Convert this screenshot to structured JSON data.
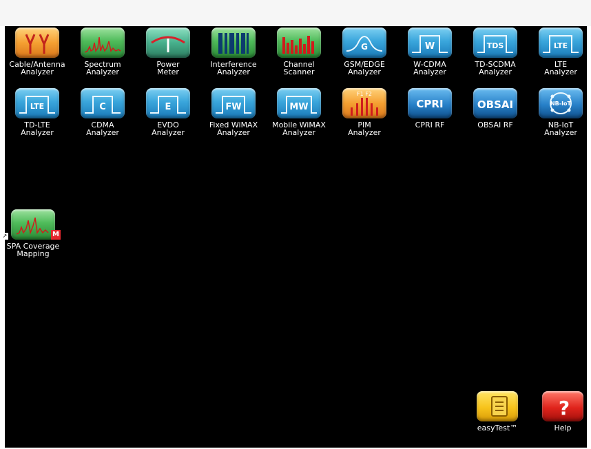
{
  "apps": [
    {
      "id": "cable-antenna",
      "label": "Cable/Antenna\nAnalyzer",
      "icon": "antenna-icon"
    },
    {
      "id": "spectrum",
      "label": "Spectrum\nAnalyzer",
      "icon": "spectrum-icon"
    },
    {
      "id": "power-meter",
      "label": "Power\nMeter",
      "icon": "power-meter-icon"
    },
    {
      "id": "interference",
      "label": "Interference\nAnalyzer",
      "icon": "interference-icon"
    },
    {
      "id": "channel-scanner",
      "label": "Channel\nScanner",
      "icon": "channel-scanner-icon"
    },
    {
      "id": "gsm-edge",
      "label": "GSM/EDGE\nAnalyzer",
      "icon": "gsm-icon",
      "tile_text": "G"
    },
    {
      "id": "wcdma",
      "label": "W-CDMA\nAnalyzer",
      "icon": "wcdma-icon",
      "tile_text": "W"
    },
    {
      "id": "td-scdma",
      "label": "TD-SCDMA\nAnalyzer",
      "icon": "tdscdma-icon",
      "tile_text": "TDS"
    },
    {
      "id": "lte",
      "label": "LTE\nAnalyzer",
      "icon": "lte-icon",
      "tile_text": "LTE"
    },
    {
      "id": "td-lte",
      "label": "TD-LTE\nAnalyzer",
      "icon": "td-lte-icon",
      "tile_text": "LTE"
    },
    {
      "id": "cdma",
      "label": "CDMA\nAnalyzer",
      "icon": "cdma-icon",
      "tile_text": "C"
    },
    {
      "id": "evdo",
      "label": "EVDO\nAnalyzer",
      "icon": "evdo-icon",
      "tile_text": "E"
    },
    {
      "id": "fixed-wimax",
      "label": "Fixed WiMAX\nAnalyzer",
      "icon": "fixed-wimax-icon",
      "tile_text": "FW"
    },
    {
      "id": "mobile-wimax",
      "label": "Mobile WiMAX\nAnalyzer",
      "icon": "mobile-wimax-icon",
      "tile_text": "MW"
    },
    {
      "id": "pim",
      "label": "PIM\nAnalyzer",
      "icon": "pim-icon",
      "tile_text": "F1 F2"
    },
    {
      "id": "cpri",
      "label": "CPRI RF",
      "icon": "cpri-icon",
      "tile_text": "CPRI"
    },
    {
      "id": "obsai",
      "label": "OBSAI RF",
      "icon": "obsai-icon",
      "tile_text": "OBSAI"
    },
    {
      "id": "nb-iot",
      "label": "NB-IoT\nAnalyzer",
      "icon": "nb-iot-icon",
      "tile_text": "NB-IoT"
    },
    {
      "id": "spa-coverage",
      "label": "SPA Coverage\nMapping",
      "icon": "coverage-mapping-icon",
      "badge": "M"
    },
    {
      "id": "easytest",
      "label": "easyTest™",
      "icon": "easytest-icon"
    },
    {
      "id": "help",
      "label": "Help",
      "icon": "help-icon",
      "tile_text": "?"
    }
  ]
}
